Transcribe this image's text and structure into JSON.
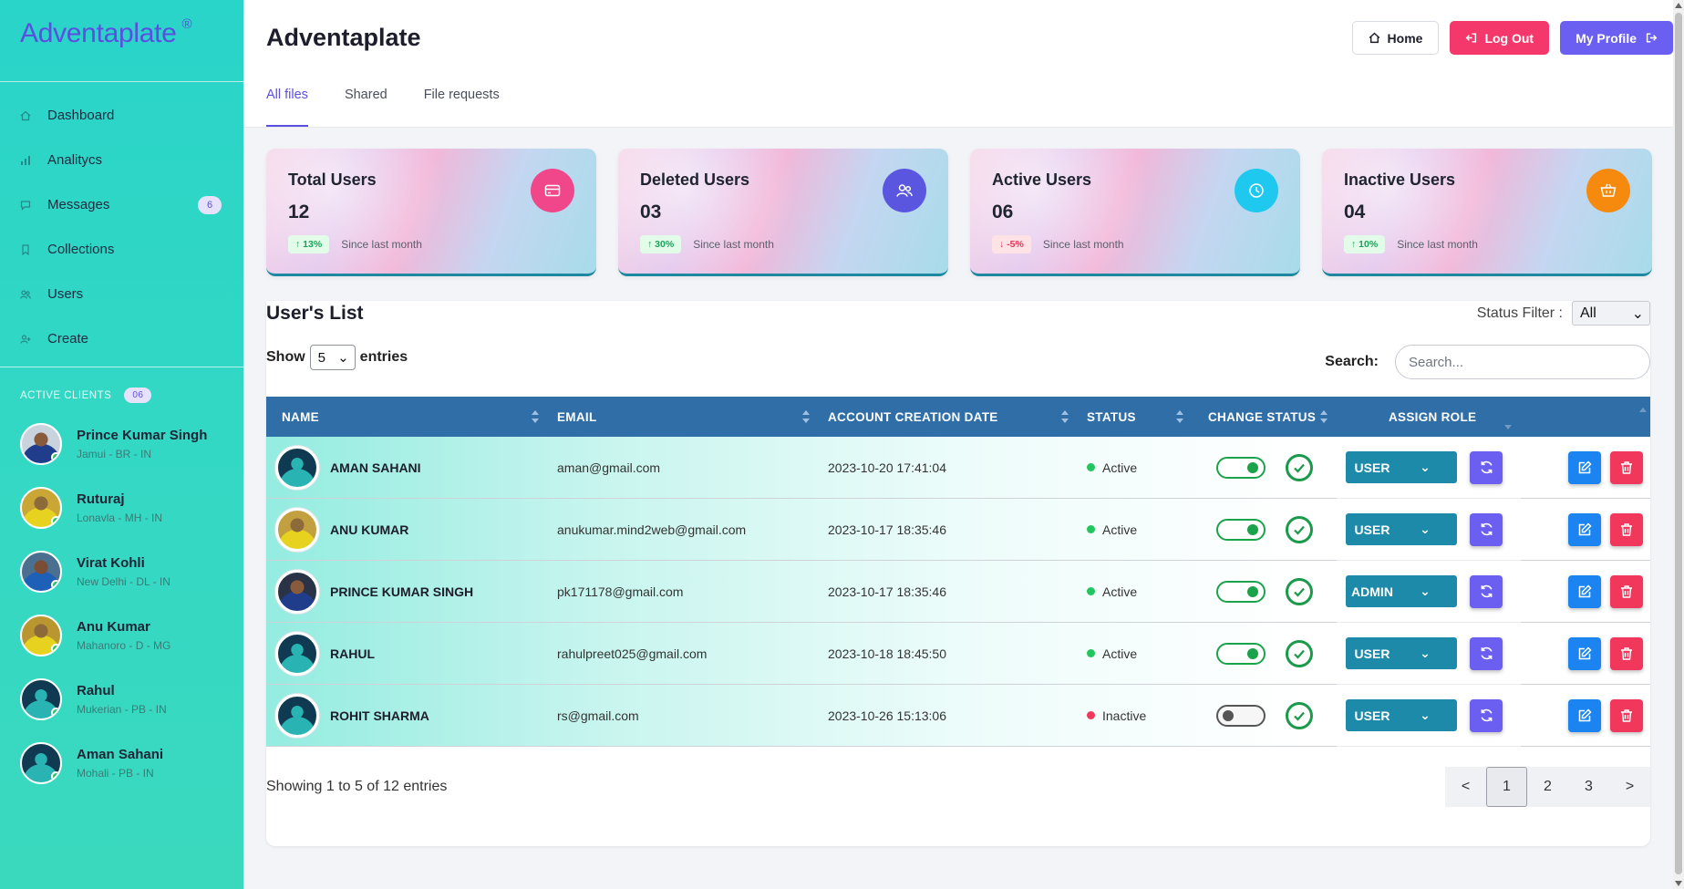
{
  "app": {
    "logo": "Adventaplate",
    "logo_mark": "®"
  },
  "sidebar": {
    "items": [
      {
        "label": "Dashboard",
        "icon": "home-icon"
      },
      {
        "label": "Analitycs",
        "icon": "bar-chart-icon"
      },
      {
        "label": "Messages",
        "icon": "chat-icon",
        "badge": "6"
      },
      {
        "label": "Collections",
        "icon": "bookmark-icon"
      },
      {
        "label": "Users",
        "icon": "users-icon"
      },
      {
        "label": "Create",
        "icon": "user-plus-icon"
      }
    ],
    "clients_title": "ACTIVE CLIENTS",
    "clients_count": "06",
    "clients": [
      {
        "name": "Prince Kumar Singh",
        "location": "Jamui - BR - IN"
      },
      {
        "name": "Ruturaj",
        "location": "Lonavla - MH - IN"
      },
      {
        "name": "Virat Kohli",
        "location": "New Delhi - DL - IN"
      },
      {
        "name": "Anu Kumar",
        "location": "Mahanoro - D - MG"
      },
      {
        "name": "Rahul",
        "location": "Mukerian - PB - IN"
      },
      {
        "name": "Aman Sahani",
        "location": "Mohali - PB - IN"
      }
    ]
  },
  "header": {
    "title": "Adventaplate",
    "home_label": "Home",
    "logout_label": "Log Out",
    "profile_label": "My Profile",
    "tabs": [
      {
        "label": "All files"
      },
      {
        "label": "Shared"
      },
      {
        "label": "File requests"
      }
    ]
  },
  "stats": [
    {
      "title": "Total Users",
      "value": "12",
      "change": "13%",
      "direction": "up",
      "since": "Since last month",
      "icon": "credit-card-icon",
      "color": "#f0468a"
    },
    {
      "title": "Deleted Users",
      "value": "03",
      "change": "30%",
      "direction": "up",
      "since": "Since last month",
      "icon": "users-icon",
      "color": "#5b56e0"
    },
    {
      "title": "Active Users",
      "value": "06",
      "change": "-5%",
      "direction": "down",
      "since": "Since last month",
      "icon": "clock-icon",
      "color": "#1ec8ee"
    },
    {
      "title": "Inactive Users",
      "value": "04",
      "change": "10%",
      "direction": "up",
      "since": "Since last month",
      "icon": "cart-icon",
      "color": "#f68a0f"
    }
  ],
  "list": {
    "title": "User's List",
    "status_filter_label": "Status Filter :",
    "status_filter_value": "All",
    "show_label": "Show",
    "show_value": "5",
    "entries_label": "entries",
    "search_label": "Search:",
    "search_placeholder": "Search...",
    "columns": [
      "NAME",
      "EMAIL",
      "ACCOUNT CREATION DATE",
      "STATUS",
      "CHANGE STATUS",
      "ASSIGN ROLE"
    ],
    "rows": [
      {
        "name": "AMAN SAHANI",
        "email": "aman@gmail.com",
        "date": "2023-10-20 17:41:04",
        "status": "Active",
        "role": "USER"
      },
      {
        "name": "ANU KUMAR",
        "email": "anukumar.mind2web@gmail.com",
        "date": "2023-10-17 18:35:46",
        "status": "Active",
        "role": "USER"
      },
      {
        "name": "PRINCE KUMAR SINGH",
        "email": "pk171178@gmail.com",
        "date": "2023-10-17 18:35:46",
        "status": "Active",
        "role": "ADMIN"
      },
      {
        "name": "RAHUL",
        "email": "rahulpreet025@gmail.com",
        "date": "2023-10-18 18:45:50",
        "status": "Active",
        "role": "USER"
      },
      {
        "name": "ROHIT SHARMA",
        "email": "rs@gmail.com",
        "date": "2023-10-26 15:13:06",
        "status": "Inactive",
        "role": "USER"
      }
    ],
    "info": "Showing 1 to 5 of 12 entries",
    "pager": {
      "prev": "<",
      "pages": [
        "1",
        "2",
        "3"
      ],
      "current": "1",
      "next": ">"
    }
  },
  "colors": {
    "accent": "#5b4fe0",
    "logout": "#f5386b",
    "profile": "#6a5ff0",
    "table_header": "#2f6ea7",
    "active": "#1aa34a",
    "inactive": "#f2375c"
  }
}
